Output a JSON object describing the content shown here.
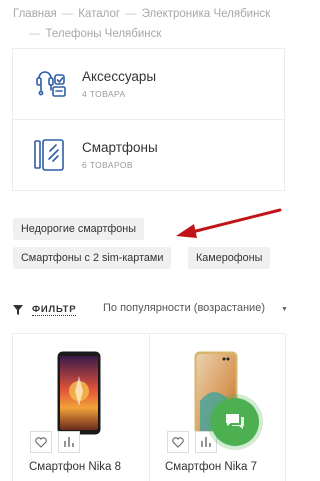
{
  "breadcrumb": [
    {
      "label": "Главная"
    },
    {
      "label": "Каталог"
    },
    {
      "label": "Электроника Челябинск"
    },
    {
      "label": "Телефоны Челябинск"
    }
  ],
  "breadcrumb_separator": "—",
  "categories": [
    {
      "title": "Аксессуары",
      "count": "4 ТОВАРА",
      "icon": "accessories-icon"
    },
    {
      "title": "Смартфоны",
      "count": "6 ТОВАРОВ",
      "icon": "smartphone-icon"
    }
  ],
  "tags": [
    {
      "label": "Недорогие смартфоны"
    },
    {
      "label": "Смартфоны с 2 sim-картами"
    },
    {
      "label": "Камерофоны"
    }
  ],
  "filter": {
    "label": "ФИЛЬТР",
    "icon": "funnel-icon"
  },
  "sort": {
    "value": "По популярности (возрастание)",
    "icon": "caret-down-icon"
  },
  "products": [
    {
      "name": "Смартфон Nika 8"
    },
    {
      "name": "Смартфон Nika 7"
    }
  ],
  "colors": {
    "accent": "#2f5fa8",
    "arrow": "#c0141b",
    "chat": "#4caf50"
  }
}
